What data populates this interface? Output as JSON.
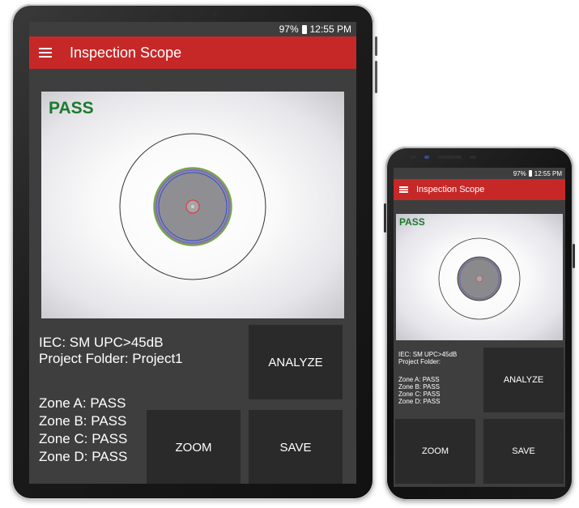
{
  "status": {
    "battery": "97%",
    "time": "12:55 PM"
  },
  "app": {
    "title": "Inspection Scope"
  },
  "result": {
    "label": "PASS",
    "color": "#1b7a2d"
  },
  "info": {
    "standard": "IEC: SM UPC>45dB",
    "tablet_folder": "Project Folder: Project1",
    "phone_folder": "Project Folder:"
  },
  "zones": [
    "Zone A: PASS",
    "Zone B: PASS",
    "Zone C: PASS",
    "Zone D: PASS"
  ],
  "buttons": {
    "analyze": "ANALYZE",
    "zoom": "ZOOM",
    "save": "SAVE"
  },
  "colors": {
    "appbar": "#c62828",
    "screen_bg": "#3e3e3e",
    "button_bg": "#2a2a2a"
  }
}
